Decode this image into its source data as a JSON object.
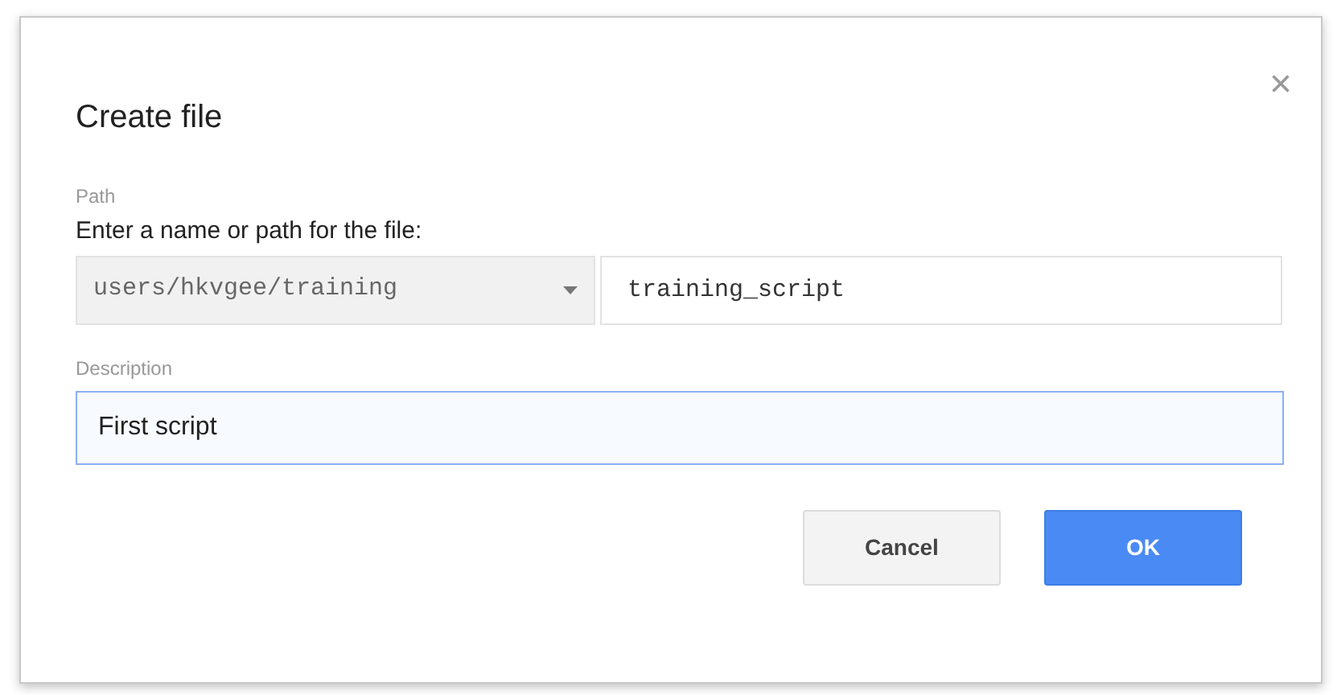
{
  "dialog": {
    "title": "Create file",
    "close": "×",
    "path": {
      "label": "Path",
      "prompt": "Enter a name or path for the file:",
      "folder": "users/hkvgee/training",
      "name_value": "training_script"
    },
    "description": {
      "label": "Description",
      "value": "First script",
      "focused": true
    },
    "buttons": [
      {
        "label": "Cancel",
        "kind": "secondary"
      },
      {
        "label": "OK",
        "kind": "primary"
      }
    ]
  }
}
